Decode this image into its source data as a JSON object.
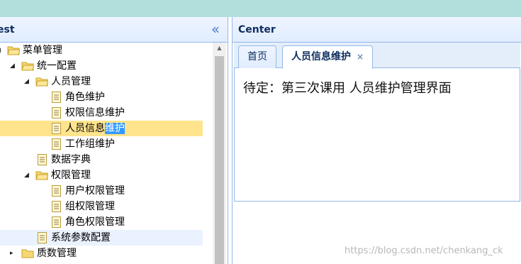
{
  "west": {
    "title": "est",
    "collapse_icon": "double-chevron-left-icon",
    "tree": [
      {
        "label": "菜单管理",
        "type": "folder",
        "expanded": true
      },
      {
        "label": "统一配置",
        "type": "folder",
        "expanded": true
      },
      {
        "label": "人员管理",
        "type": "folder",
        "expanded": true
      },
      {
        "label": "角色维护",
        "type": "file"
      },
      {
        "label": "权限信息维护",
        "type": "file"
      },
      {
        "label_plain": "人员信息",
        "label_highlight": "维护",
        "type": "file",
        "selected": true
      },
      {
        "label": "工作组维护",
        "type": "file"
      },
      {
        "label": "数据字典",
        "type": "file"
      },
      {
        "label": "权限管理",
        "type": "folder",
        "expanded": true
      },
      {
        "label": "用户权限管理",
        "type": "file"
      },
      {
        "label": "组权限管理",
        "type": "file"
      },
      {
        "label": "角色权限管理",
        "type": "file"
      },
      {
        "label": "系统参数配置",
        "type": "file",
        "hover": true
      },
      {
        "label": "质数管理",
        "type": "folder"
      }
    ]
  },
  "center": {
    "title": "Center",
    "tabs": [
      {
        "label": "首页",
        "active": false
      },
      {
        "label": "人员信息维护",
        "active": true,
        "close_icon": "×"
      }
    ],
    "content_text": "待定：第三次课用 人员维护管理界面"
  },
  "watermark": "https://blog.csdn.net/chenkang_ck",
  "colors": {
    "top_bar": "#b2dfdb",
    "panel_border": "#95b8e7",
    "selected_node": "#ffe48d",
    "text_highlight": "#3399ff",
    "title_text": "#0e2d5f"
  }
}
